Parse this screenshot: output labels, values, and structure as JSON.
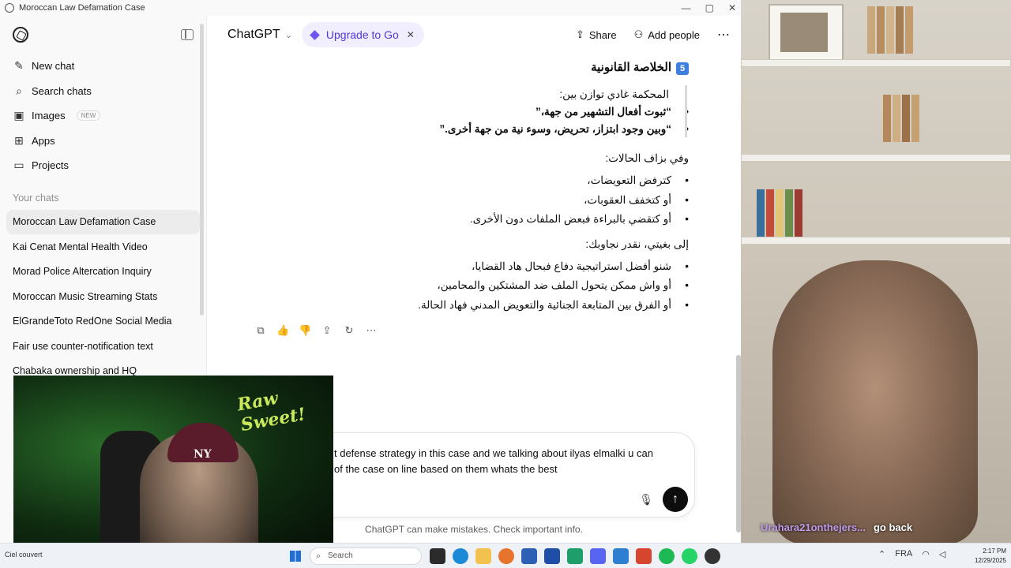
{
  "window": {
    "title": "Moroccan Law Defamation Case"
  },
  "sidebar": {
    "items": [
      {
        "icon": "new-chat-icon",
        "label": "New chat"
      },
      {
        "icon": "search-icon",
        "label": "Search chats"
      },
      {
        "icon": "images-icon",
        "label": "Images",
        "badge": "NEW"
      },
      {
        "icon": "apps-icon",
        "label": "Apps"
      },
      {
        "icon": "projects-icon",
        "label": "Projects"
      }
    ],
    "section_title": "Your chats",
    "chats": [
      "Moroccan Law Defamation Case",
      "Kai Cenat Mental Health Video",
      "Morad Police Altercation Inquiry",
      "Moroccan Music Streaming Stats",
      "ElGrandeToto RedOne Social Media",
      "Fair use counter-notification text",
      "Chabaka ownership and HQ"
    ]
  },
  "topbar": {
    "model": "ChatGPT",
    "upgrade": "Upgrade to Go",
    "share": "Share",
    "add_people": "Add people"
  },
  "message": {
    "heading_num": "5",
    "heading": "الخلاصة القانونية",
    "quote_intro": "المحكمة غادي توازن بين:",
    "quote_bullets": [
      "“ثبوت أفعال التشهير من جهة،”",
      "“وبين وجود ابتزاز، تحريض، وسوء نية من جهة أخرى.”"
    ],
    "para2": "وفي بزاف الحالات:",
    "bullets2": [
      "كترفض التعويضات،",
      "أو كتخفف العقوبات،",
      "أو كتقضي بالبراءة فبعض الملفات دون الأخرى."
    ],
    "para3": "إلى بغيتي، نقدر نجاوبك:",
    "bullets3": [
      "شنو أفضل استراتيجية دفاع فبحال هاد القضايا،",
      "أو واش ممكن يتحول الملف ضد المشتكين والمحامين،",
      "أو الفرق بين المتابعة الجنائية والتعويض المدني فهاد الحالة."
    ]
  },
  "composer": {
    "line1": "t defense strategy in this case and we talking about ilyas elmalki u can",
    "line2": "of the case on line based on them whats the best"
  },
  "disclaimer": "ChatGPT can make mistakes. Check important info.",
  "webcam": {
    "neon": "Raw Sweet!",
    "cap": "NY"
  },
  "video_caption": {
    "user": "Urahara21onthejers...",
    "message": "go back"
  },
  "taskbar": {
    "weather": "Ciel couvert",
    "search": "Search",
    "lang": "FRA",
    "time": "2:17 PM",
    "date": "12/29/2025"
  }
}
